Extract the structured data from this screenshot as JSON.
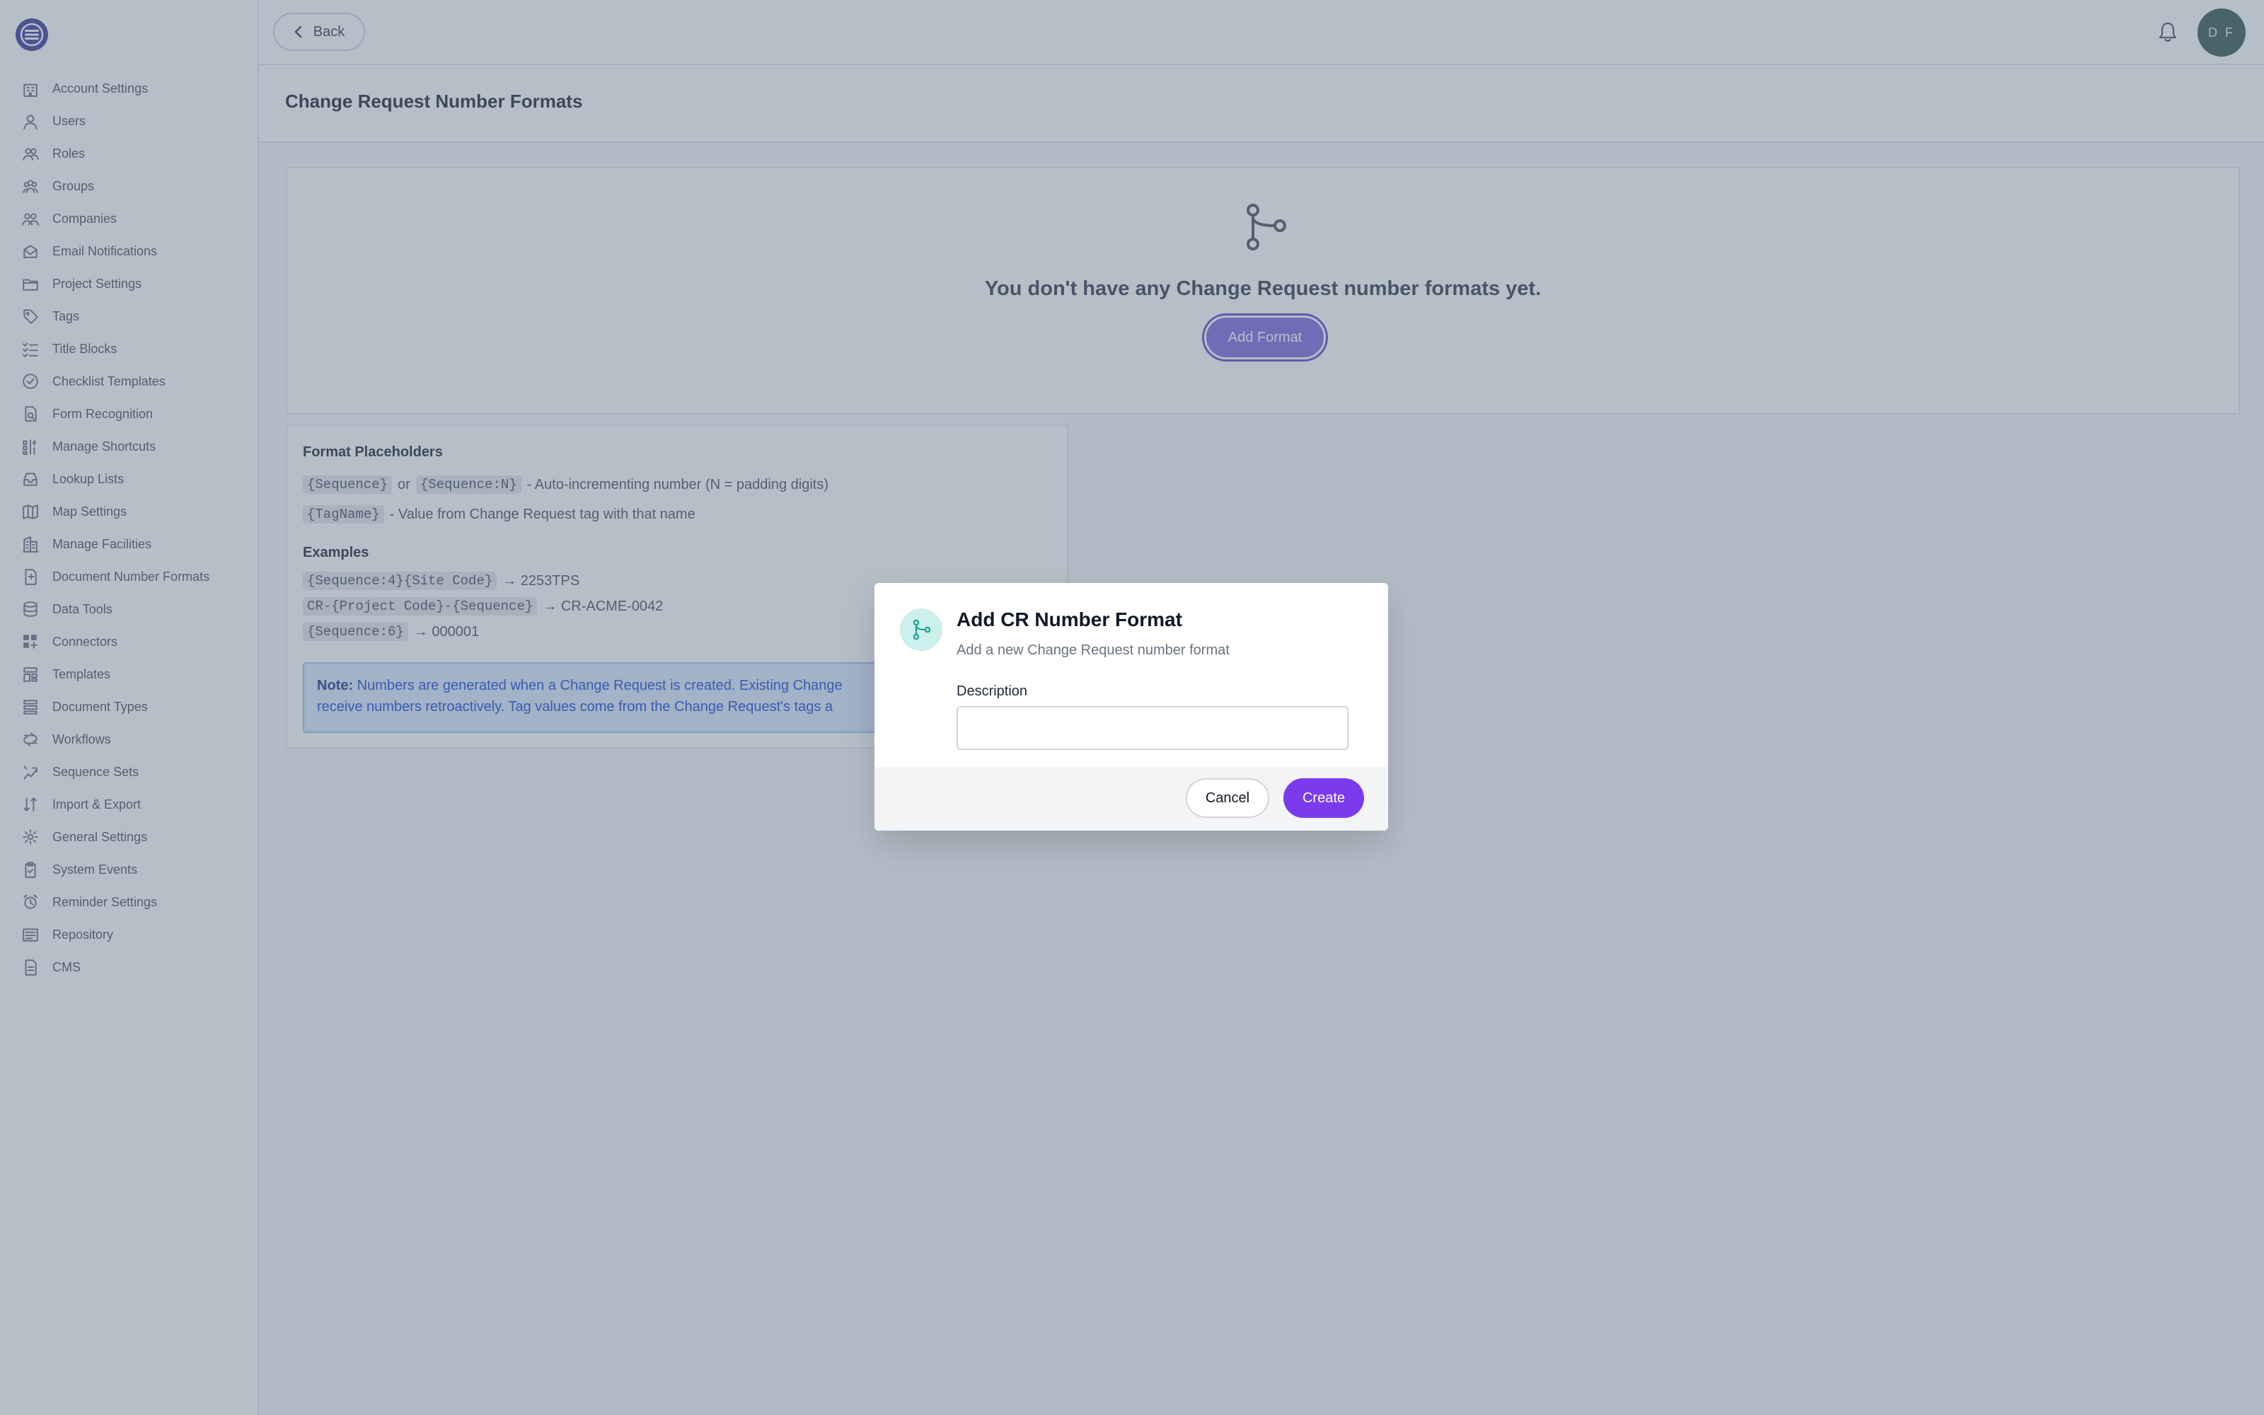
{
  "sidebar": {
    "items": [
      {
        "label": "Account Settings",
        "icon": "building-icon"
      },
      {
        "label": "Users",
        "icon": "user-icon"
      },
      {
        "label": "Roles",
        "icon": "roles-icon"
      },
      {
        "label": "Groups",
        "icon": "group-icon"
      },
      {
        "label": "Companies",
        "icon": "companies-icon"
      },
      {
        "label": "Email Notifications",
        "icon": "mail-icon"
      },
      {
        "label": "Project Settings",
        "icon": "folder-icon"
      },
      {
        "label": "Tags",
        "icon": "tag-icon"
      },
      {
        "label": "Title Blocks",
        "icon": "list-check-icon"
      },
      {
        "label": "Checklist Templates",
        "icon": "check-circle-icon"
      },
      {
        "label": "Form Recognition",
        "icon": "form-scan-icon"
      },
      {
        "label": "Manage Shortcuts",
        "icon": "shortcut-icon"
      },
      {
        "label": "Lookup Lists",
        "icon": "inbox-icon"
      },
      {
        "label": "Map Settings",
        "icon": "map-icon"
      },
      {
        "label": "Manage Facilities",
        "icon": "facility-icon"
      },
      {
        "label": "Document Number Formats",
        "icon": "document-number-icon"
      },
      {
        "label": "Data Tools",
        "icon": "database-icon"
      },
      {
        "label": "Connectors",
        "icon": "grid-plus-icon"
      },
      {
        "label": "Templates",
        "icon": "template-icon"
      },
      {
        "label": "Document Types",
        "icon": "document-types-icon"
      },
      {
        "label": "Workflows",
        "icon": "workflow-icon"
      },
      {
        "label": "Sequence Sets",
        "icon": "sequence-icon"
      },
      {
        "label": "Import & Export",
        "icon": "import-export-icon"
      },
      {
        "label": "General Settings",
        "icon": "gear-icon"
      },
      {
        "label": "System Events",
        "icon": "clipboard-check-icon"
      },
      {
        "label": "Reminder Settings",
        "icon": "alarm-icon"
      },
      {
        "label": "Repository",
        "icon": "repository-icon"
      },
      {
        "label": "CMS",
        "icon": "file-icon"
      }
    ]
  },
  "topbar": {
    "back_label": "Back",
    "avatar_initials": "D F"
  },
  "page": {
    "title": "Change Request Number Formats"
  },
  "empty_state": {
    "message": "You don't have any Change Request number formats yet.",
    "button_label": "Add Format"
  },
  "placeholders": {
    "heading": "Format Placeholders",
    "lines": [
      {
        "codes": [
          "{Sequence}",
          "{Sequence:N}"
        ],
        "joiner": "or",
        "desc": "- Auto-incrementing number (N = padding digits)"
      },
      {
        "codes": [
          "{TagName}"
        ],
        "desc": "- Value from Change Request tag with that name"
      }
    ],
    "examples_heading": "Examples",
    "examples": [
      {
        "code": "{Sequence:4}{Site Code}",
        "result": "→ 2253TPS"
      },
      {
        "code": "CR-{Project Code}-{Sequence}",
        "result": "→ CR-ACME-0042"
      },
      {
        "code": "{Sequence:6}",
        "result": "→ 000001"
      }
    ],
    "note_label": "Note:",
    "note_line1": "Numbers are generated when a Change Request is created. Existing Change",
    "note_line2": "receive numbers retroactively. Tag values come from the Change Request's tags a"
  },
  "modal": {
    "title": "Add CR Number Format",
    "subtitle": "Add a new Change Request number format",
    "field_label": "Description",
    "field_value": "",
    "cancel_label": "Cancel",
    "create_label": "Create"
  },
  "colors": {
    "accent": "#7c3aed",
    "teal": "#0f9f8f",
    "overlay": "#5e6e86"
  }
}
